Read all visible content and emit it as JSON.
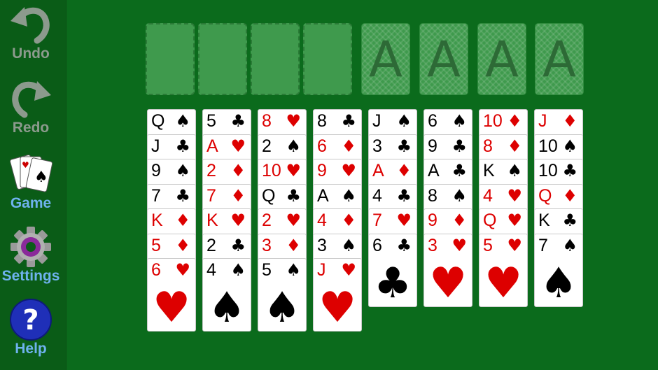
{
  "sidebar": {
    "undo": "Undo",
    "redo": "Redo",
    "game": "Game",
    "settings": "Settings",
    "help": "Help"
  },
  "free_cells": [
    null,
    null,
    null,
    null
  ],
  "foundations": [
    "A",
    "A",
    "A",
    "A"
  ],
  "tableau": [
    [
      {
        "rank": "Q",
        "suit": "♠"
      },
      {
        "rank": "J",
        "suit": "♣"
      },
      {
        "rank": "9",
        "suit": "♠"
      },
      {
        "rank": "7",
        "suit": "♣"
      },
      {
        "rank": "K",
        "suit": "♦"
      },
      {
        "rank": "5",
        "suit": "♦"
      },
      {
        "rank": "6",
        "suit": "♥"
      }
    ],
    [
      {
        "rank": "5",
        "suit": "♣"
      },
      {
        "rank": "A",
        "suit": "♥"
      },
      {
        "rank": "2",
        "suit": "♦"
      },
      {
        "rank": "7",
        "suit": "♦"
      },
      {
        "rank": "K",
        "suit": "♥"
      },
      {
        "rank": "2",
        "suit": "♣"
      },
      {
        "rank": "4",
        "suit": "♠"
      }
    ],
    [
      {
        "rank": "8",
        "suit": "♥"
      },
      {
        "rank": "2",
        "suit": "♠"
      },
      {
        "rank": "10",
        "suit": "♥"
      },
      {
        "rank": "Q",
        "suit": "♣"
      },
      {
        "rank": "2",
        "suit": "♥"
      },
      {
        "rank": "3",
        "suit": "♦"
      },
      {
        "rank": "5",
        "suit": "♠"
      }
    ],
    [
      {
        "rank": "8",
        "suit": "♣"
      },
      {
        "rank": "6",
        "suit": "♦"
      },
      {
        "rank": "9",
        "suit": "♥"
      },
      {
        "rank": "A",
        "suit": "♠"
      },
      {
        "rank": "4",
        "suit": "♦"
      },
      {
        "rank": "3",
        "suit": "♠"
      },
      {
        "rank": "J",
        "suit": "♥"
      }
    ],
    [
      {
        "rank": "J",
        "suit": "♠"
      },
      {
        "rank": "3",
        "suit": "♣"
      },
      {
        "rank": "A",
        "suit": "♦"
      },
      {
        "rank": "4",
        "suit": "♣"
      },
      {
        "rank": "7",
        "suit": "♥"
      },
      {
        "rank": "6",
        "suit": "♣"
      }
    ],
    [
      {
        "rank": "6",
        "suit": "♠"
      },
      {
        "rank": "9",
        "suit": "♣"
      },
      {
        "rank": "A",
        "suit": "♣"
      },
      {
        "rank": "8",
        "suit": "♠"
      },
      {
        "rank": "9",
        "suit": "♦"
      },
      {
        "rank": "3",
        "suit": "♥"
      }
    ],
    [
      {
        "rank": "10",
        "suit": "♦"
      },
      {
        "rank": "8",
        "suit": "♦"
      },
      {
        "rank": "K",
        "suit": "♠"
      },
      {
        "rank": "4",
        "suit": "♥"
      },
      {
        "rank": "Q",
        "suit": "♥"
      },
      {
        "rank": "5",
        "suit": "♥"
      }
    ],
    [
      {
        "rank": "J",
        "suit": "♦"
      },
      {
        "rank": "10",
        "suit": "♠"
      },
      {
        "rank": "10",
        "suit": "♣"
      },
      {
        "rank": "Q",
        "suit": "♦"
      },
      {
        "rank": "K",
        "suit": "♣"
      },
      {
        "rank": "7",
        "suit": "♠"
      }
    ]
  ]
}
